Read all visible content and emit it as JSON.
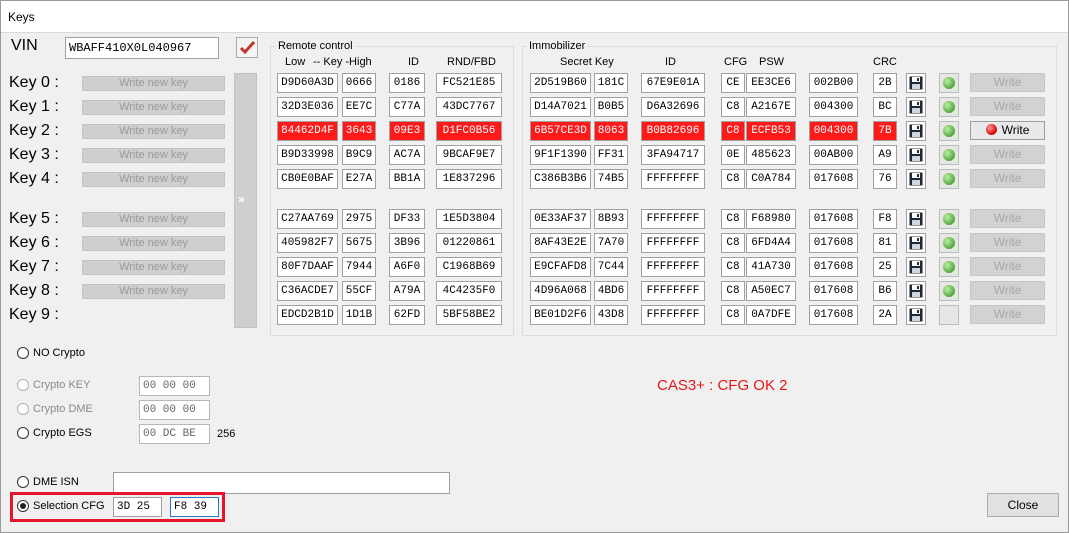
{
  "window": {
    "title": "Keys"
  },
  "vin": {
    "label": "VIN",
    "value": "WBAFF410X0L040967"
  },
  "key_labels": [
    "Key 0 :",
    "Key 1 :",
    "Key 2 :",
    "Key 3 :",
    "Key 4 :",
    "Key 5 :",
    "Key 6 :",
    "Key 7 :",
    "Key 8 :",
    "Key 9 :"
  ],
  "write_new_key_label": "Write new key",
  "arrow_label": "»",
  "remote": {
    "title": "Remote control",
    "headers": {
      "low": "Low",
      "key_high": "-- Key -High",
      "id": "ID",
      "rnd": "RND/FBD"
    },
    "rows": [
      {
        "low": "D9D60A3D",
        "high": "0666",
        "id": "0186",
        "rnd": "FC521E85"
      },
      {
        "low": "32D3E036",
        "high": "EE7C",
        "id": "C77A",
        "rnd": "43DC7767"
      },
      {
        "low": "84462D4F",
        "high": "3643",
        "id": "09E3",
        "rnd": "D1FC0B56"
      },
      {
        "low": "B9D33998",
        "high": "B9C9",
        "id": "AC7A",
        "rnd": "9BCAF9E7"
      },
      {
        "low": "CB0E0BAF",
        "high": "E27A",
        "id": "BB1A",
        "rnd": "1E837296"
      },
      {
        "low": "C27AA769",
        "high": "2975",
        "id": "DF33",
        "rnd": "1E5D3804"
      },
      {
        "low": "405982F7",
        "high": "5675",
        "id": "3B96",
        "rnd": "01220861"
      },
      {
        "low": "80F7DAAF",
        "high": "7944",
        "id": "A6F0",
        "rnd": "C1968B69"
      },
      {
        "low": "C36ACDE7",
        "high": "55CF",
        "id": "A79A",
        "rnd": "4C4235F0"
      },
      {
        "low": "EDCD2B1D",
        "high": "1D1B",
        "id": "62FD",
        "rnd": "5BF58BE2"
      }
    ]
  },
  "immobilizer": {
    "title": "Immobilizer",
    "headers": {
      "secret_key": "Secret Key",
      "id": "ID",
      "cfg": "CFG",
      "psw": "PSW",
      "crc": "CRC"
    },
    "rows": [
      {
        "sk1": "2D519B60",
        "sk2": "181C",
        "id": "67E9E01A",
        "cfg": "CE",
        "psw": "EE3CE6",
        "psw2": "002B00",
        "crc": "2B"
      },
      {
        "sk1": "D14A7021",
        "sk2": "B0B5",
        "id": "D6A32696",
        "cfg": "C8",
        "psw": "A2167E",
        "psw2": "004300",
        "crc": "BC"
      },
      {
        "sk1": "6B57CE3D",
        "sk2": "8063",
        "id": "B0B82696",
        "cfg": "C8",
        "psw": "ECFB53",
        "psw2": "004300",
        "crc": "7B"
      },
      {
        "sk1": "9F1F1390",
        "sk2": "FF31",
        "id": "3FA94717",
        "cfg": "0E",
        "psw": "485623",
        "psw2": "00AB00",
        "crc": "A9"
      },
      {
        "sk1": "C386B3B6",
        "sk2": "74B5",
        "id": "FFFFFFFF",
        "cfg": "C8",
        "psw": "C0A784",
        "psw2": "017608",
        "crc": "76"
      },
      {
        "sk1": "0E33AF37",
        "sk2": "8B93",
        "id": "FFFFFFFF",
        "cfg": "C8",
        "psw": "F68980",
        "psw2": "017608",
        "crc": "F8"
      },
      {
        "sk1": "8AF43E2E",
        "sk2": "7A70",
        "id": "FFFFFFFF",
        "cfg": "C8",
        "psw": "6FD4A4",
        "psw2": "017608",
        "crc": "81"
      },
      {
        "sk1": "E9CFAFD8",
        "sk2": "7C44",
        "id": "FFFFFFFF",
        "cfg": "C8",
        "psw": "41A730",
        "psw2": "017608",
        "crc": "25"
      },
      {
        "sk1": "4D96A068",
        "sk2": "4BD6",
        "id": "FFFFFFFF",
        "cfg": "C8",
        "psw": "A50EC7",
        "psw2": "017608",
        "crc": "B6"
      },
      {
        "sk1": "BE01D2F6",
        "sk2": "43D8",
        "id": "FFFFFFFF",
        "cfg": "C8",
        "psw": "0A7DFE",
        "psw2": "017608",
        "crc": "2A"
      }
    ]
  },
  "write_label": "Write",
  "crypto": {
    "no_crypto": "NO Crypto",
    "key": {
      "label": "Crypto KEY",
      "value": "00 00 00"
    },
    "dme": {
      "label": "Crypto DME",
      "value": "00 00 00"
    },
    "egs": {
      "label": "Crypto EGS",
      "value": "00 DC BE",
      "suffix": "256"
    },
    "dme_isn": {
      "label": "DME ISN",
      "value": ""
    },
    "selection_cfg": {
      "label": "Selection CFG",
      "v1": "3D 25",
      "v2": "F8 39"
    }
  },
  "status": "CAS3+ : CFG OK 2",
  "close_label": "Close",
  "colors": {
    "highlight": "#ff1a1a",
    "status": "#e31818",
    "callout": "#e5152b"
  }
}
